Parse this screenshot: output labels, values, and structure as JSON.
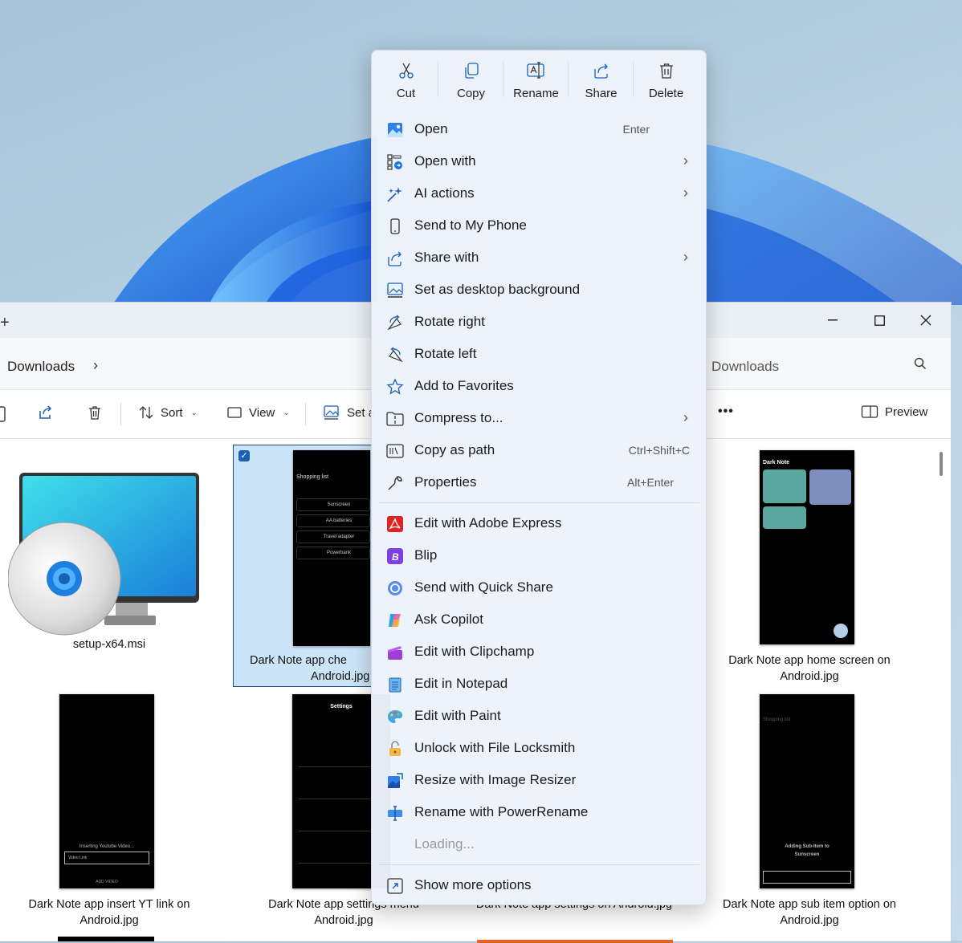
{
  "explorer": {
    "breadcrumb": "Downloads",
    "search_placeholder": "Downloads",
    "toolbar": {
      "sort": "Sort",
      "view": "View",
      "set": "Set a",
      "more": "•••",
      "preview": "Preview"
    }
  },
  "files": [
    {
      "name": "setup-x64.msi"
    },
    {
      "name": "Dark Note app checklist on Android.jpg",
      "visible_line1": "Dark Note app che",
      "visible_line2": "Android.jpg"
    },
    {
      "name": "Dark Note app home screen on Android.jpg",
      "visible_line1": "Dark Note app home screen on",
      "visible_line2": "Android.jpg"
    },
    {
      "name": "Dark Note app insert YT link on Android.jpg",
      "visible_line1": "Dark Note app insert YT link on",
      "visible_line2": "Android.jpg"
    },
    {
      "name": "Dark Note app settings menu Android.jpg",
      "visible_line1": "Dark Note app settings menu",
      "visible_line2": "Android.jpg"
    },
    {
      "name": "Dark Note app settings on Android.jpg",
      "visible_line1": "Dark Note app settings on Android.jpg"
    },
    {
      "name": "Dark Note app sub item option on Android.jpg",
      "visible_line1": "Dark Note app sub item option on",
      "visible_line2": "Android.jpg"
    }
  ],
  "context_menu": {
    "quick_actions": [
      {
        "label": "Cut",
        "icon": "scissors-icon"
      },
      {
        "label": "Copy",
        "icon": "copy-icon"
      },
      {
        "label": "Rename",
        "icon": "rename-icon"
      },
      {
        "label": "Share",
        "icon": "share-icon"
      },
      {
        "label": "Delete",
        "icon": "trash-icon"
      }
    ],
    "items": [
      {
        "label": "Open",
        "shortcut": "Enter"
      },
      {
        "label": "Open with",
        "submenu": true
      },
      {
        "label": "AI actions",
        "submenu": true
      },
      {
        "label": "Send to My Phone"
      },
      {
        "label": "Share with",
        "submenu": true
      },
      {
        "label": "Set as desktop background"
      },
      {
        "label": "Rotate right"
      },
      {
        "label": "Rotate left"
      },
      {
        "label": "Add to Favorites"
      },
      {
        "label": "Compress to...",
        "submenu": true
      },
      {
        "label": "Copy as path",
        "shortcut": "Ctrl+Shift+C"
      },
      {
        "label": "Properties",
        "shortcut": "Alt+Enter"
      },
      {
        "label": "Edit with Adobe Express"
      },
      {
        "label": "Blip"
      },
      {
        "label": "Send with Quick Share"
      },
      {
        "label": "Ask Copilot"
      },
      {
        "label": "Edit with Clipchamp"
      },
      {
        "label": "Edit in Notepad"
      },
      {
        "label": "Edit with Paint"
      },
      {
        "label": "Unlock with File Locksmith"
      },
      {
        "label": "Resize with Image Resizer"
      },
      {
        "label": "Rename with PowerRename"
      },
      {
        "label": "Loading..."
      },
      {
        "label": "Show more options"
      }
    ]
  },
  "thumb_text": {
    "shopping_list": "Shopping list",
    "item1": "Sunscreen",
    "item2": "AA batteries",
    "item3": "Travel adapter",
    "item4": "Powerbank",
    "dark_note": "Dark Note",
    "settings": "Settings",
    "inserting": "Inserting Youtube Video...",
    "video_link": "Video Link",
    "add_video": "ADD VIDEO",
    "adding_sub": "Adding Sub-Item to",
    "sunscreen": "Sunscreen"
  }
}
